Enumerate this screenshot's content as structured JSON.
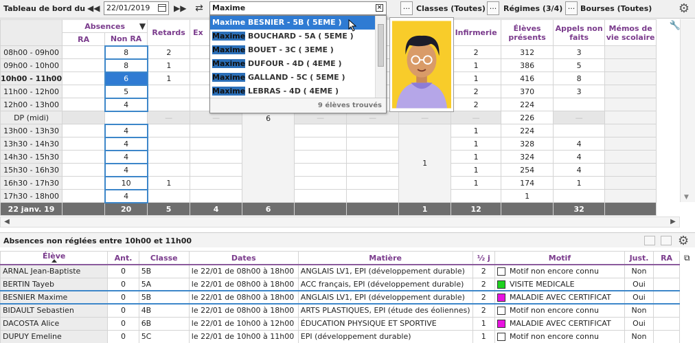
{
  "toolbar": {
    "title": "Tableau de bord du",
    "prev": "◀◀",
    "next": "▶▶",
    "date": "22/01/2019",
    "search_value": "Maxime",
    "dots": "...",
    "classes": "Classes (Toutes)",
    "regimes": "Régimes (3/4)",
    "bourses": "Bourses (Toutes)"
  },
  "grid": {
    "headers": {
      "absences": "Absences",
      "ra": "RA",
      "nonra": "Non RA",
      "retards": "Retards",
      "ex": "Ex",
      "infirmerie": "Infirmerie",
      "eleves_presents": "Élèves présents",
      "appels_non_faits": "Appels non faits",
      "memos": "Mémos de vie scolaire"
    },
    "rows": [
      {
        "label": "08h00 - 09h00",
        "nonra": "8",
        "retards": "2",
        "infirmerie": "2",
        "eleves": "312",
        "appels": "3"
      },
      {
        "label": "09h00 - 10h00",
        "nonra": "8",
        "retards": "1",
        "infirmerie": "1",
        "eleves": "386",
        "appels": "5"
      },
      {
        "label": "10h00 - 11h00",
        "nonra": "6",
        "retards": "1",
        "infirmerie": "1",
        "eleves": "416",
        "appels": "8"
      },
      {
        "label": "11h00 - 12h00",
        "nonra": "5",
        "retards": "",
        "infirmerie": "2",
        "eleves": "370",
        "appels": "3"
      },
      {
        "label": "12h00 - 13h00",
        "nonra": "4",
        "retards": "",
        "infirmerie": "2",
        "eleves": "224",
        "appels": ""
      },
      {
        "label": "DP (midi)",
        "nonra": "",
        "retards": "",
        "infirmerie": "",
        "eleves": "226",
        "appels": ""
      },
      {
        "label": "13h00 - 13h30",
        "nonra": "4",
        "retards": "",
        "infirmerie": "1",
        "eleves": "224",
        "appels": ""
      },
      {
        "label": "13h30 - 14h30",
        "nonra": "4",
        "retards": "",
        "infirmerie": "1",
        "eleves": "328",
        "appels": "4"
      },
      {
        "label": "14h30 - 15h30",
        "nonra": "4",
        "retards": "",
        "infirmerie": "1",
        "eleves": "324",
        "appels": "4"
      },
      {
        "label": "15h30 - 16h30",
        "nonra": "4",
        "retards": "",
        "infirmerie": "1",
        "eleves": "254",
        "appels": "4"
      },
      {
        "label": "16h30 - 17h30",
        "nonra": "10",
        "retards": "1",
        "infirmerie": "1",
        "eleves": "174",
        "appels": "1"
      },
      {
        "label": "17h30 - 18h00",
        "nonra": "4",
        "retards": "",
        "infirmerie": "",
        "eleves": "1",
        "appels": ""
      }
    ],
    "merged_col3": "6",
    "merged_col6": "1",
    "dp_dash": "—",
    "totals": {
      "label": "22 janv. 19",
      "nonra": "20",
      "retards": "5",
      "c1": "4",
      "c2": "6",
      "c3": "1",
      "infirmerie": "12",
      "appels": "32"
    }
  },
  "dropdown": {
    "items": [
      {
        "hl": "Maxime",
        "rest": " BESNIER - 5B ( 5EME )"
      },
      {
        "hl": "Maxime",
        "rest": " BOUCHARD - 5A ( 5EME )"
      },
      {
        "hl": "Maxime",
        "rest": " BOUET - 3C ( 3EME )"
      },
      {
        "hl": "Maxime",
        "rest": " DUFOUR - 4D ( 4EME )"
      },
      {
        "hl": "Maxime",
        "rest": " GALLAND - 5C ( 5EME )"
      },
      {
        "hl": "Maxime",
        "rest": " LEBRAS - 4D ( 4EME )"
      }
    ],
    "footer": "9 élèves trouvés"
  },
  "absences": {
    "title": "Absences non réglées entre 10h00 et 11h00",
    "headers": {
      "eleve": "Élève",
      "ant": "Ant.",
      "classe": "Classe",
      "dates": "Dates",
      "matiere": "Matière",
      "demi": "½ j",
      "motif": "Motif",
      "just": "Just.",
      "ra": "RA"
    },
    "rows": [
      {
        "eleve": "ARNAL Jean-Baptiste",
        "ant": "0",
        "classe": "5B",
        "dates": "le 22/01 de 08h00 à 18h00",
        "matiere": "ANGLAIS LV1, EPI (développement durable)",
        "demi": "2",
        "color": "#ffffff",
        "motif": "Motif non encore connu",
        "just": "Non"
      },
      {
        "eleve": "BERTIN Tayeb",
        "ant": "0",
        "classe": "5A",
        "dates": "le 22/01 de 08h00 à 18h00",
        "matiere": "ACC français, EPI (développement durable)",
        "demi": "2",
        "color": "#1ed21e",
        "motif": "VISITE MEDICALE",
        "just": "Oui"
      },
      {
        "eleve": "BESNIER Maxime",
        "ant": "0",
        "classe": "5B",
        "dates": "le 22/01 de 08h00 à 18h00",
        "matiere": "ANGLAIS LV1, EPI (développement durable)",
        "demi": "2",
        "color": "#e812e0",
        "motif": "MALADIE AVEC CERTIFICAT",
        "just": "Oui"
      },
      {
        "eleve": "BIDAULT Sebastien",
        "ant": "0",
        "classe": "4B",
        "dates": "le 22/01 de 08h00 à 18h00",
        "matiere": "ARTS PLASTIQUES, EPI (étude des éoliennes)",
        "demi": "2",
        "color": "#ffffff",
        "motif": "Motif non encore connu",
        "just": "Non"
      },
      {
        "eleve": "DACOSTA Alice",
        "ant": "0",
        "classe": "6B",
        "dates": "le 22/01 de 10h00 à 12h00",
        "matiere": "ÉDUCATION PHYSIQUE ET SPORTIVE",
        "demi": "1",
        "color": "#e812e0",
        "motif": "MALADIE AVEC CERTIFICAT",
        "just": "Oui"
      },
      {
        "eleve": "DUPUY Emeline",
        "ant": "0",
        "classe": "5C",
        "dates": "le 22/01 de 10h00 à 11h00",
        "matiere": "EPI (développement durable)",
        "demi": "1",
        "color": "#ffffff",
        "motif": "Motif non encore connu",
        "just": "Non"
      }
    ]
  }
}
